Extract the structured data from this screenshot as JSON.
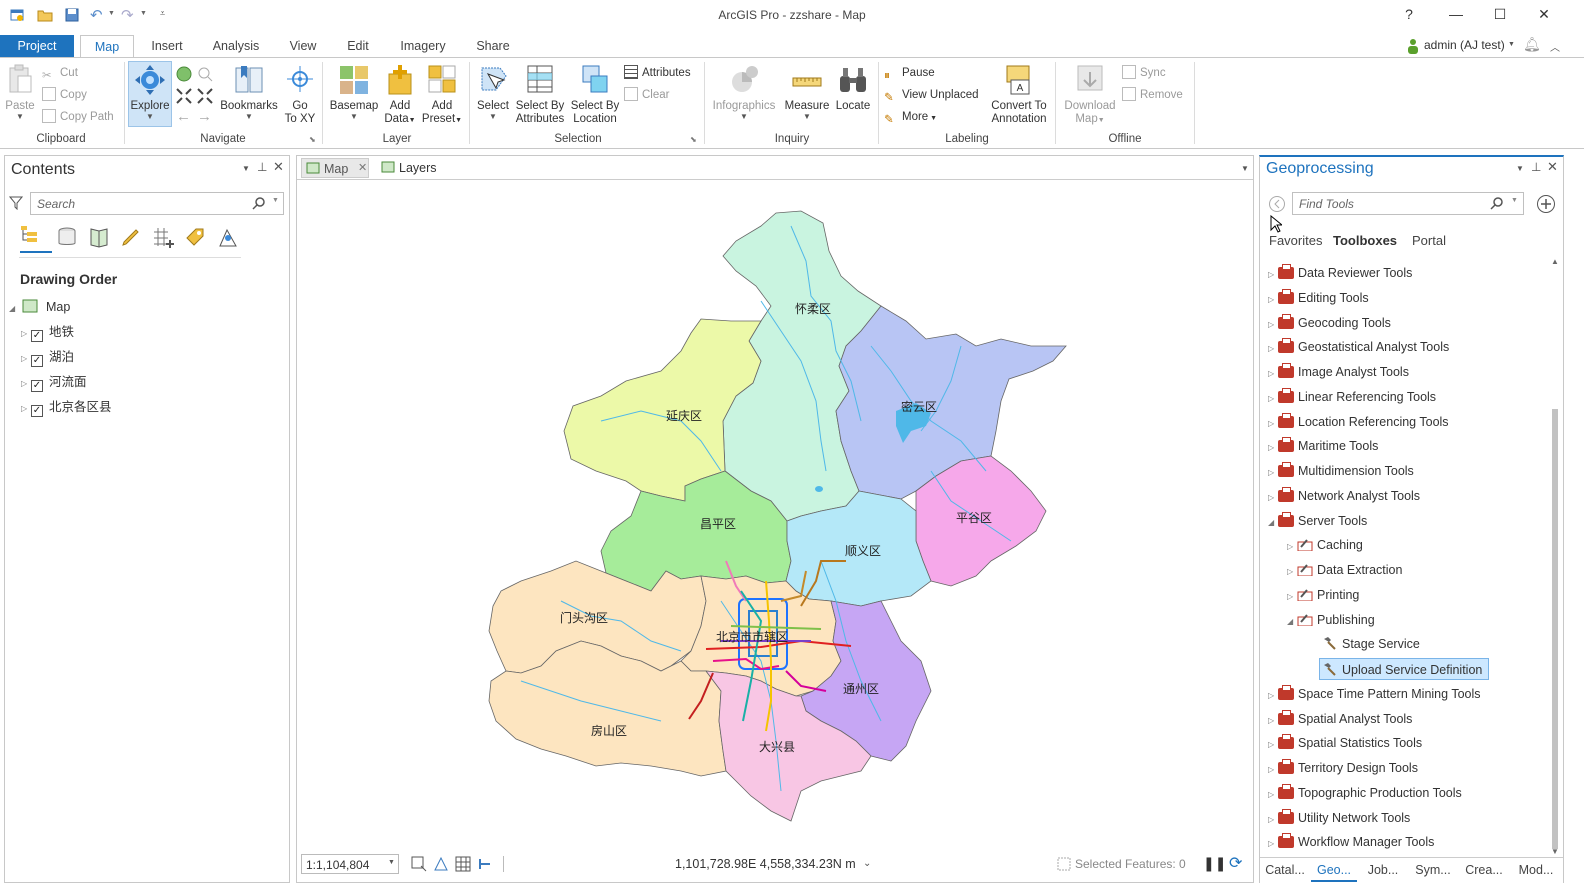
{
  "window": {
    "title": "ArcGIS Pro - zzshare - Map",
    "help": "?",
    "user": "admin (AJ test)"
  },
  "ribbon_tabs": [
    {
      "label": "Project"
    },
    {
      "label": "Map"
    },
    {
      "label": "Insert"
    },
    {
      "label": "Analysis"
    },
    {
      "label": "View"
    },
    {
      "label": "Edit"
    },
    {
      "label": "Imagery"
    },
    {
      "label": "Share"
    }
  ],
  "clipboard": {
    "paste": "Paste",
    "cut": "Cut",
    "copy": "Copy",
    "copy_path": "Copy Path",
    "group": "Clipboard"
  },
  "navigate": {
    "explore": "Explore",
    "bookmarks": "Bookmarks",
    "go_to_xy_1": "Go",
    "go_to_xy_2": "To XY",
    "group": "Navigate"
  },
  "layer": {
    "basemap": "Basemap",
    "add_data_1": "Add",
    "add_data_2": "Data",
    "add_preset_1": "Add",
    "add_preset_2": "Preset",
    "group": "Layer"
  },
  "selection": {
    "select": "Select",
    "by_attr_1": "Select By",
    "by_attr_2": "Attributes",
    "by_loc_1": "Select By",
    "by_loc_2": "Location",
    "attributes": "Attributes",
    "clear": "Clear",
    "group": "Selection"
  },
  "inquiry": {
    "infographics": "Infographics",
    "measure": "Measure",
    "locate": "Locate",
    "group": "Inquiry"
  },
  "labeling": {
    "pause": "Pause",
    "view_unplaced": "View Unplaced",
    "more": "More",
    "convert_1": "Convert To",
    "convert_2": "Annotation",
    "group": "Labeling"
  },
  "offline": {
    "download_1": "Download",
    "download_2": "Map",
    "sync": "Sync",
    "remove": "Remove",
    "group": "Offline"
  },
  "contents": {
    "title": "Contents",
    "search_placeholder": "Search",
    "section": "Drawing Order",
    "map_label": "Map",
    "layers": [
      {
        "label": "地铁"
      },
      {
        "label": "湖泊"
      },
      {
        "label": "河流面"
      },
      {
        "label": "北京各区县"
      }
    ]
  },
  "map_tabs": {
    "map": "Map",
    "layers": "Layers"
  },
  "map_labels": {
    "huairou": "怀柔区",
    "miyun": "密云区",
    "yanqing": "延庆区",
    "changping": "昌平区",
    "shunyi": "顺义区",
    "pinggu": "平谷区",
    "mentougou": "门头沟区",
    "chengqu": "北京市市辖区",
    "tongzhou": "通州区",
    "fangshan": "房山区",
    "daxing": "大兴县"
  },
  "statusbar": {
    "scale": "1:1,104,804",
    "coords": "1,101,728.98E 4,558,334.23N m",
    "selected": "Selected Features: 0"
  },
  "geoprocessing": {
    "title": "Geoprocessing",
    "search_placeholder": "Find Tools",
    "tabs": {
      "favorites": "Favorites",
      "toolboxes": "Toolboxes",
      "portal": "Portal"
    },
    "rows": [
      {
        "label": "Data Reviewer Tools"
      },
      {
        "label": "Editing Tools"
      },
      {
        "label": "Geocoding Tools"
      },
      {
        "label": "Geostatistical Analyst Tools"
      },
      {
        "label": "Image Analyst Tools"
      },
      {
        "label": "Linear Referencing Tools"
      },
      {
        "label": "Location Referencing Tools"
      },
      {
        "label": "Maritime Tools"
      },
      {
        "label": "Multidimension Tools"
      },
      {
        "label": "Network Analyst Tools"
      },
      {
        "label": "Server Tools"
      },
      {
        "label": "Caching"
      },
      {
        "label": "Data Extraction"
      },
      {
        "label": "Printing"
      },
      {
        "label": "Publishing"
      },
      {
        "label": "Stage Service"
      },
      {
        "label": "Upload Service Definition"
      },
      {
        "label": "Space Time Pattern Mining Tools"
      },
      {
        "label": "Spatial Analyst Tools"
      },
      {
        "label": "Spatial Statistics Tools"
      },
      {
        "label": "Territory Design Tools"
      },
      {
        "label": "Topographic Production Tools"
      },
      {
        "label": "Utility Network Tools"
      },
      {
        "label": "Workflow Manager Tools"
      }
    ],
    "bottom_tabs": [
      {
        "label": "Catal..."
      },
      {
        "label": "Geo..."
      },
      {
        "label": "Job..."
      },
      {
        "label": "Sym..."
      },
      {
        "label": "Crea..."
      },
      {
        "label": "Mod..."
      }
    ]
  },
  "colors": {
    "accent": "#1e73be",
    "toolbox": "#c0392b",
    "selected_row": "#cde8ff"
  }
}
